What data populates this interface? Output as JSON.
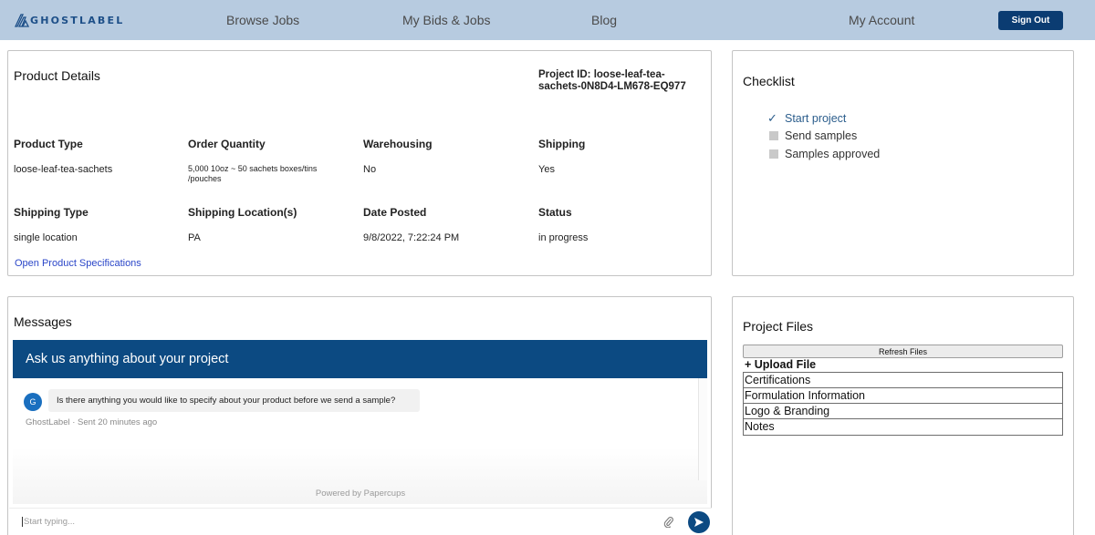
{
  "brand": {
    "name": "GHOSTLABEL"
  },
  "nav": {
    "browse_jobs": "Browse Jobs",
    "my_bids_jobs": "My Bids & Jobs",
    "blog": "Blog",
    "my_account": "My Account",
    "sign_out": "Sign Out"
  },
  "product": {
    "title": "Product Details",
    "project_id": "Project ID: loose-leaf-tea-sachets-0N8D4-LM678-EQ977",
    "fields": [
      {
        "label": "Product Type",
        "value": "loose-leaf-tea-sachets"
      },
      {
        "label": "Order Quantity",
        "value": "5,000 10oz ~ 50 sachets boxes/tins /pouches"
      },
      {
        "label": "Warehousing",
        "value": "No"
      },
      {
        "label": "Shipping",
        "value": "Yes"
      },
      {
        "label": "Shipping Type",
        "value": "single location"
      },
      {
        "label": "Shipping Location(s)",
        "value": "PA"
      },
      {
        "label": "Date Posted",
        "value": "9/8/2022, 7:22:24 PM"
      },
      {
        "label": "Status",
        "value": "in progress"
      }
    ],
    "spec_link": "Open Product Specifications"
  },
  "checklist": {
    "title": "Checklist",
    "items": [
      {
        "label": "Start project",
        "done": true
      },
      {
        "label": "Send samples",
        "done": false
      },
      {
        "label": "Samples approved",
        "done": false
      }
    ]
  },
  "messages": {
    "title": "Messages",
    "banner": "Ask us anything about your project",
    "avatar_initial": "G",
    "message_text": "Is there anything you would like to specify about your product before we send a sample?",
    "meta": "GhostLabel · Sent 20 minutes ago",
    "powered_by": "Powered by Papercups",
    "input_placeholder": "Start typing..."
  },
  "files": {
    "title": "Project Files",
    "refresh_label": "Refresh Files",
    "upload_label": "+ Upload File",
    "items": [
      "Certifications",
      "Formulation Information",
      "Logo & Branding",
      "Notes"
    ]
  },
  "colors": {
    "header_bg": "#b7cbe0",
    "brand_blue": "#0c4a82",
    "link_blue": "#2b46c8"
  }
}
